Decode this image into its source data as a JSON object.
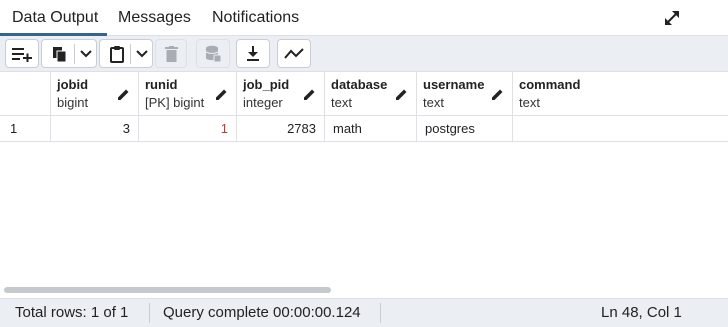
{
  "tabs": [
    {
      "label": "Data Output",
      "active": true
    },
    {
      "label": "Messages",
      "active": false
    },
    {
      "label": "Notifications",
      "active": false
    }
  ],
  "toolbar": {
    "buttons": [
      "add-row-icon",
      "copy-icon",
      "dropdown-icon",
      "paste-icon",
      "dropdown-icon",
      "delete-icon",
      "save-data-icon",
      "download-icon",
      "graph-icon"
    ]
  },
  "grid": {
    "columns": [
      {
        "name": "",
        "type": ""
      },
      {
        "name": "jobid",
        "type": "bigint"
      },
      {
        "name": "runid",
        "type": "[PK] bigint"
      },
      {
        "name": "job_pid",
        "type": "integer"
      },
      {
        "name": "database",
        "type": "text"
      },
      {
        "name": "username",
        "type": "text"
      },
      {
        "name": "command",
        "type": "text"
      }
    ],
    "rows": [
      {
        "rownum": "1",
        "jobid": "3",
        "runid": "1",
        "job_pid": "2783",
        "database": "math",
        "username": "postgres",
        "command": ""
      }
    ]
  },
  "status": {
    "total_rows": "Total rows: 1 of 1",
    "query": "Query complete 00:00:00.124",
    "position": "Ln 48, Col 1"
  },
  "colors": {
    "accent": "#326690",
    "toolbar_bg": "#ebeef3",
    "border": "#dde0e6",
    "runid_value": "#c0392b"
  }
}
